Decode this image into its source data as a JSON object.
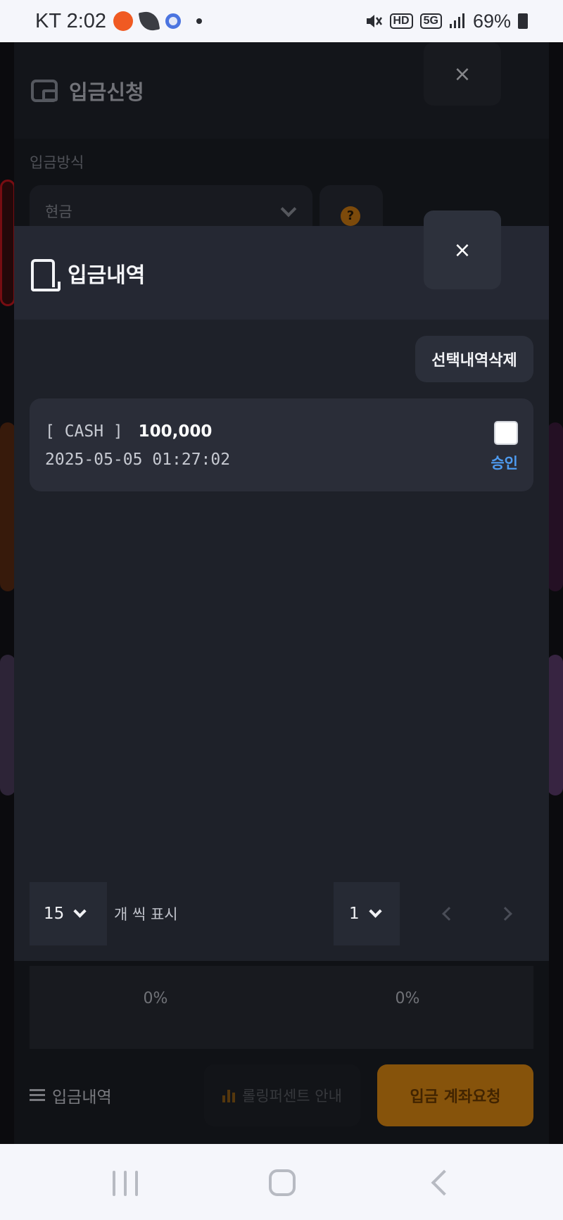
{
  "status_bar": {
    "carrier_time": "KT 2:02",
    "battery": "69%",
    "hd_label": "HD",
    "net_label": "5G"
  },
  "under_modal": {
    "title": "입금신청",
    "method_label": "입금방식",
    "method_value": "현금",
    "help_label": "?",
    "rate_left": "0%",
    "rate_right": "0%",
    "history_button": "입금내역",
    "rolling_button": "롤링퍼센트 안내",
    "request_button": "입금 계좌요청",
    "close_label": "×"
  },
  "history_modal": {
    "title": "입금내역",
    "close_label": "×",
    "delete_button": "선택내역삭제",
    "entries": [
      {
        "method": "[ CASH ]",
        "amount": "100,000",
        "datetime": "2025-05-05 01:27:02",
        "status": "승인"
      }
    ],
    "per_page_value": "15",
    "per_page_label": "개 씩 표시",
    "page_value": "1"
  },
  "colors": {
    "accent_orange": "#d98612",
    "status_blue": "#4e9bf0",
    "modal_bg": "#1e2129"
  }
}
